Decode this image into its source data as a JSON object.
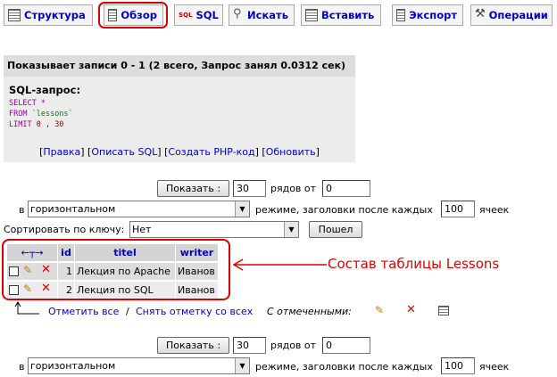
{
  "tabs": [
    {
      "label": "Структура",
      "icon": "table-structure-icon"
    },
    {
      "label": "Обзор",
      "icon": "browse-icon"
    },
    {
      "label": "SQL",
      "icon": "sql-icon"
    },
    {
      "label": "Искать",
      "icon": "search-icon"
    },
    {
      "label": "Вставить",
      "icon": "insert-icon"
    },
    {
      "label": "Экспорт",
      "icon": "export-icon"
    },
    {
      "label": "Операции",
      "icon": "operations-icon"
    }
  ],
  "info": {
    "header": "Показывает записи 0 - 1 (2 всего, Запрос занял 0.0312 сек)",
    "sql_title": "SQL-запрос:",
    "sql_select": "SELECT *",
    "sql_from_kw": "FROM",
    "sql_from_table": "`lessons`",
    "sql_limit_kw": "LIMIT",
    "sql_limit_val": "0 , 30",
    "links": [
      "Правка",
      "Описать SQL",
      "Создать PHP-код",
      "Обновить"
    ]
  },
  "nav_top": {
    "show_button": "Показать :",
    "rows_value": "30",
    "rows_label": "рядов от",
    "from_value": "0",
    "mode_prefix": "в",
    "mode_value": "горизонтальном",
    "mode_label": "режиме, заголовки после каждых",
    "headers_value": "100",
    "cells_label": "ячеек"
  },
  "sort": {
    "label": "Сортировать по ключу:",
    "value": "Нет",
    "go_button": "Пошел"
  },
  "table": {
    "columns": [
      "id",
      "titel",
      "writer"
    ],
    "rows": [
      {
        "id": "1",
        "titel": "Лекция по Apache",
        "writer": "Иванов"
      },
      {
        "id": "2",
        "titel": "Лекция по SQL",
        "writer": "Иванов"
      }
    ]
  },
  "annotation": "Состав таблицы Lessons",
  "mass_actions": {
    "check_all": "Отметить все",
    "separator": "/",
    "uncheck_all": "Снять отметку со всех",
    "with_selected": "С отмеченными:"
  },
  "nav_bottom": {
    "show_button": "Показать :",
    "rows_value": "30",
    "rows_label": "рядов от",
    "from_value": "0",
    "mode_prefix": "в",
    "mode_value": "горизонтальном",
    "mode_label": "режиме, заголовки после каждых",
    "headers_value": "100",
    "cells_label": "ячеек"
  },
  "colors": {
    "annotation": "#e00000",
    "link": "#0000cc"
  }
}
